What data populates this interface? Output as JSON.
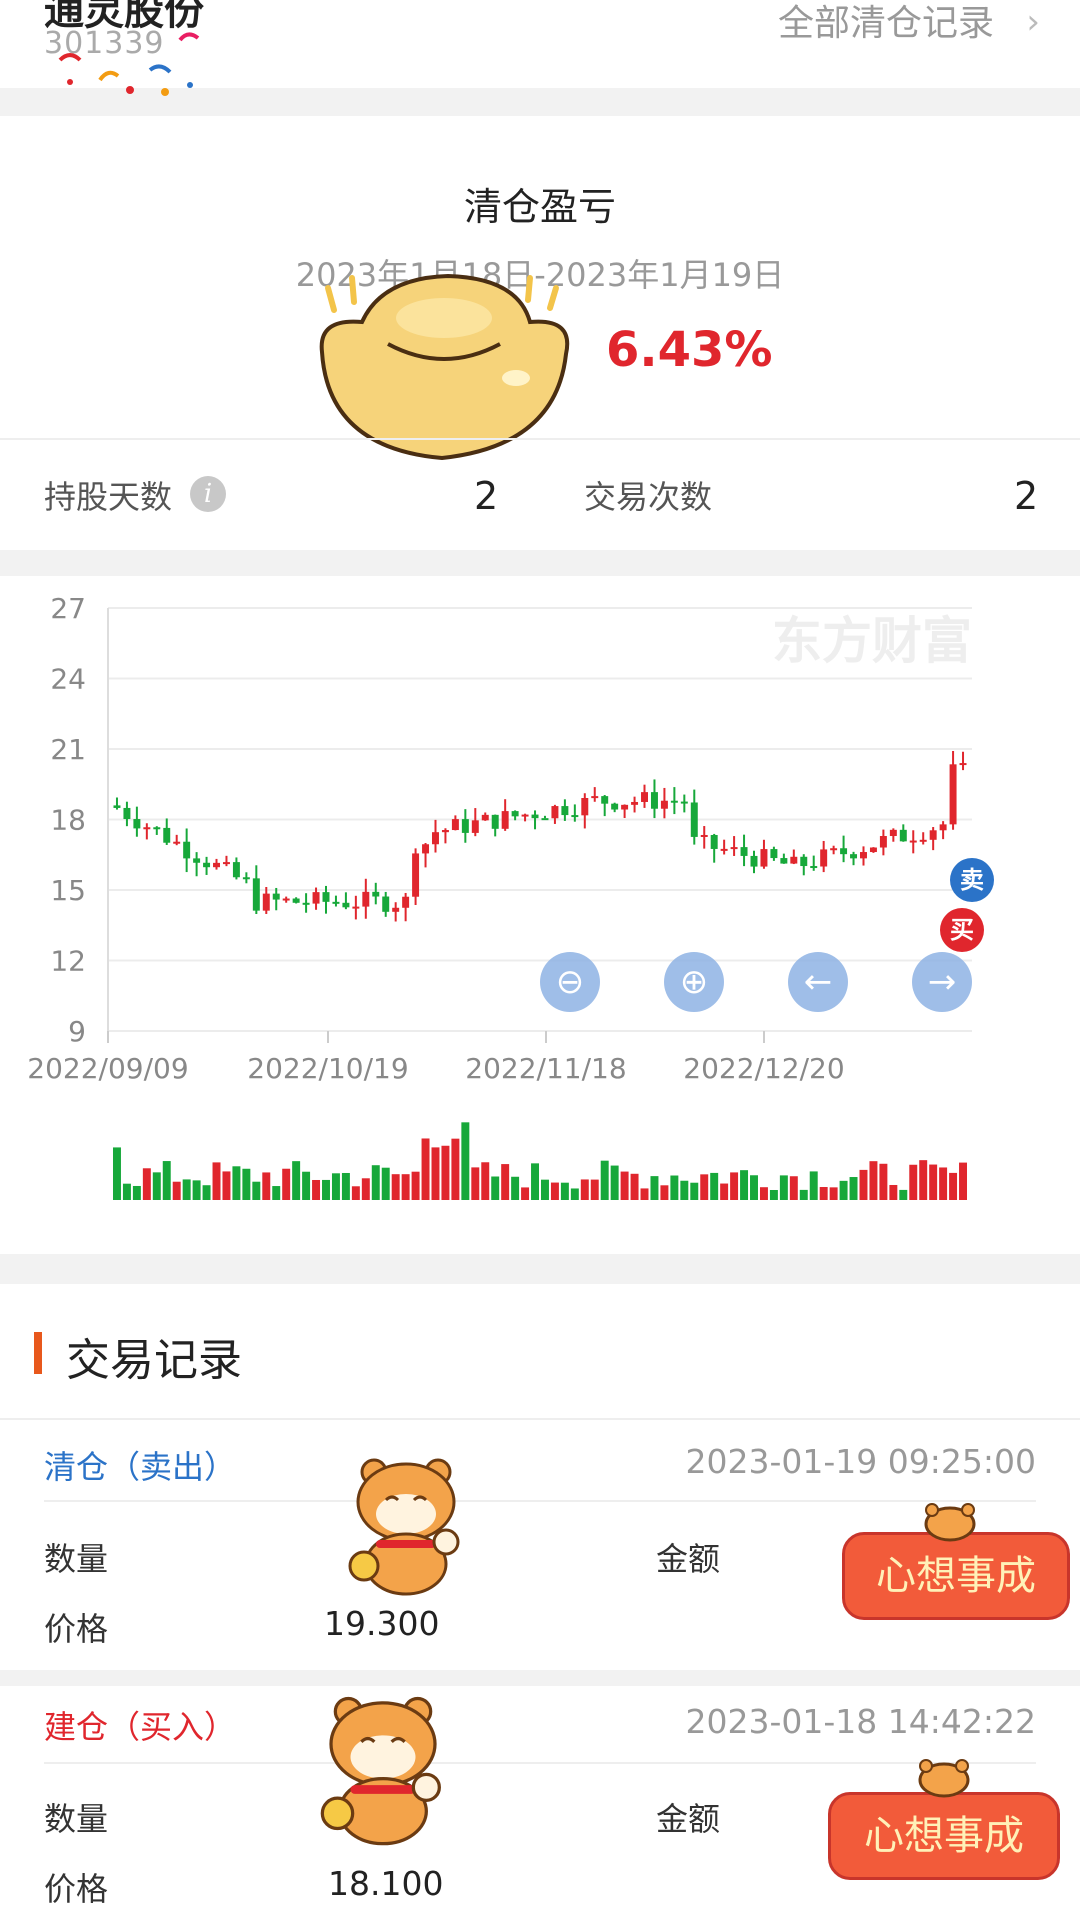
{
  "header": {
    "stock_name": "通灵股份",
    "stock_code": "301339",
    "all_records_label": "全部清仓记录",
    "chevron": "chevron-right-icon"
  },
  "summary": {
    "title": "清仓盈亏",
    "date_range": "2023年1月18日-2023年1月19日",
    "profit_pct": "6.43%",
    "hold_days_label": "持股天数",
    "hold_days_value": "2",
    "trade_count_label": "交易次数",
    "trade_count_value": "2",
    "info_icon": "info-icon"
  },
  "chart": {
    "watermark": "东方财富",
    "y_ticks": [
      "27",
      "24",
      "21",
      "18",
      "15",
      "12",
      "9"
    ],
    "x_ticks": [
      "2022/09/09",
      "2022/10/19",
      "2022/11/18",
      "2022/12/20"
    ],
    "sell_badge": "卖",
    "buy_badge": "买",
    "buttons": [
      "zoom-out-icon",
      "zoom-in-icon",
      "arrow-left-icon",
      "arrow-right-icon"
    ],
    "up_color": "#e0262d",
    "down_color": "#17a83a"
  },
  "records": {
    "title": "交易记录",
    "items": [
      {
        "type": "清仓（卖出）",
        "time": "2023-01-19 09:25:00",
        "qty_label": "数量",
        "amount_label": "金额",
        "price_label": "价格",
        "price": "19.300",
        "banner": "心想事成"
      },
      {
        "type": "建仓（买入）",
        "time": "2023-01-18 14:42:22",
        "qty_label": "数量",
        "amount_label": "金额",
        "price_label": "价格",
        "price": "18.100",
        "banner": "心想事成"
      }
    ]
  }
}
